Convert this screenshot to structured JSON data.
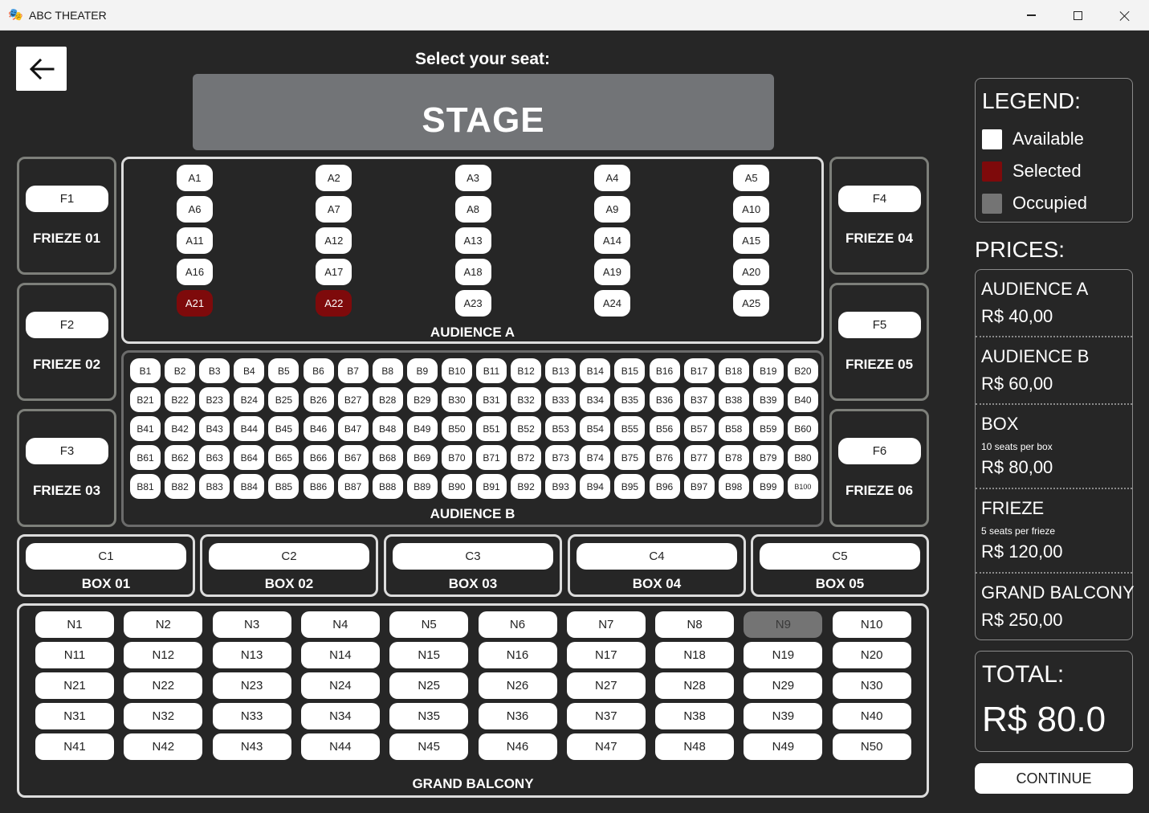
{
  "window": {
    "title": "ABC THEATER",
    "icon": "theater-masks-icon"
  },
  "header": {
    "prompt": "Select your seat:",
    "back_icon": "arrow-left-icon"
  },
  "stage": {
    "label": "STAGE"
  },
  "colors": {
    "available": "#ffffff",
    "selected": "#7e0a0b",
    "occupied": "#747474",
    "background": "#262626"
  },
  "friezes": [
    {
      "seat": "F1",
      "label": "FRIEZE 01"
    },
    {
      "seat": "F2",
      "label": "FRIEZE 02"
    },
    {
      "seat": "F3",
      "label": "FRIEZE 03"
    },
    {
      "seat": "F4",
      "label": "FRIEZE 04"
    },
    {
      "seat": "F5",
      "label": "FRIEZE 05"
    },
    {
      "seat": "F6",
      "label": "FRIEZE 06"
    }
  ],
  "audience_a": {
    "label": "AUDIENCE A",
    "seat_count": 25,
    "prefix": "A",
    "columns": 5,
    "selected": [
      "A21",
      "A22"
    ],
    "occupied": []
  },
  "audience_b": {
    "label": "AUDIENCE B",
    "seat_count": 100,
    "prefix": "B",
    "columns": 20,
    "selected": [],
    "occupied": []
  },
  "boxes": [
    {
      "seat": "C1",
      "label": "BOX 01"
    },
    {
      "seat": "C2",
      "label": "BOX 02"
    },
    {
      "seat": "C3",
      "label": "BOX 03"
    },
    {
      "seat": "C4",
      "label": "BOX 04"
    },
    {
      "seat": "C5",
      "label": "BOX 05"
    }
  ],
  "grand_balcony": {
    "label": "GRAND BALCONY",
    "seat_count": 50,
    "prefix": "N",
    "columns": 10,
    "selected": [],
    "occupied": [
      "N9"
    ]
  },
  "legend": {
    "title": "LEGEND:",
    "items": [
      {
        "label": "Available",
        "state": "available"
      },
      {
        "label": "Selected",
        "state": "selected"
      },
      {
        "label": "Occupied",
        "state": "occupied"
      }
    ]
  },
  "prices": {
    "title": "PRICES:",
    "items": [
      {
        "name": "AUDIENCE A",
        "note": "",
        "price": "R$ 40,00"
      },
      {
        "name": "AUDIENCE B",
        "note": "",
        "price": "R$ 60,00"
      },
      {
        "name": "BOX",
        "note": "10 seats per box",
        "price": "R$ 80,00"
      },
      {
        "name": "FRIEZE",
        "note": "5 seats per frieze",
        "price": "R$ 120,00"
      },
      {
        "name": "GRAND BALCONY",
        "note": "",
        "price": "R$ 250,00"
      }
    ]
  },
  "total": {
    "label": "TOTAL:",
    "value": "R$ 80.0"
  },
  "continue_label": "CONTINUE"
}
